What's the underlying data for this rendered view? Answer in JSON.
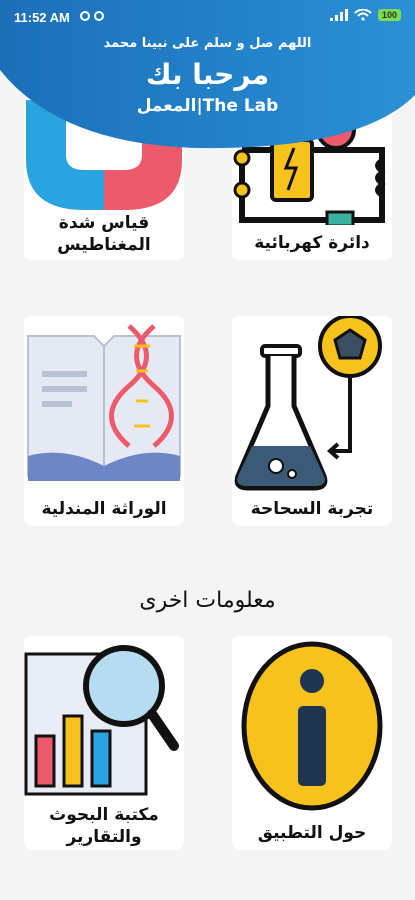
{
  "status": {
    "time": "11:52 AM",
    "battery": "100"
  },
  "header": {
    "prayer": "اللهم صل و سلم على نبينا محمد",
    "welcome": "مرحبا بك",
    "subtitle": "المعمل|The Lab"
  },
  "cards": {
    "magnetism": "قياس شدة المغناطيس",
    "circuit": "دائرة كهربائية",
    "genetics": "الوراثة المندلية",
    "experiment": "تجربة السحاحة",
    "library": "مكتبة البحوث والتقارير",
    "about": "حول التطبيق"
  },
  "section_title": "معلومات اخرى",
  "colors": {
    "header_blue": "#1e7fc4",
    "accent_yellow": "#f7c21c",
    "accent_red": "#e8455a"
  }
}
